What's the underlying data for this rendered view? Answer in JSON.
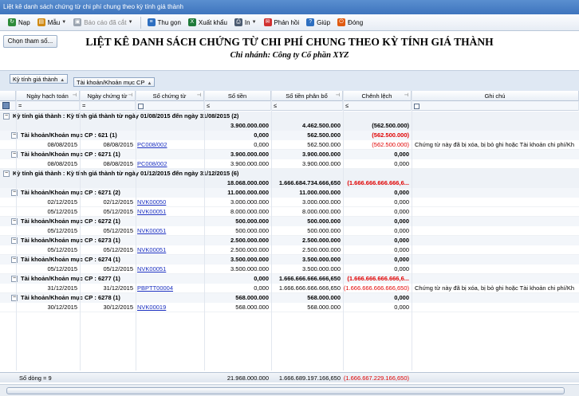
{
  "window": {
    "title": "Liệt kê danh sách chứng từ chi phí chung theo kỳ tính giá thành"
  },
  "toolbar": {
    "items": [
      {
        "label": "Nạp",
        "icon": "refresh-icon",
        "color": "#2e8b3a"
      },
      {
        "label": "Mẫu",
        "icon": "template-icon",
        "color": "#d08a14"
      },
      {
        "label": "Báo cáo đã cắt",
        "icon": "saved-report-icon",
        "color": "#9aa4b0"
      },
      {
        "label": "Thu gọn",
        "icon": "collapse-icon",
        "color": "#2e6fc0"
      },
      {
        "label": "Xuất khẩu",
        "icon": "excel-icon",
        "color": "#1f7a3a"
      },
      {
        "label": "In",
        "icon": "print-icon",
        "color": "#4a5a70"
      },
      {
        "label": "Phản hồi",
        "icon": "feedback-icon",
        "color": "#d03030"
      },
      {
        "label": "Giúp",
        "icon": "help-icon",
        "color": "#2e6fc0"
      },
      {
        "label": "Đóng",
        "icon": "close-icon",
        "color": "#e05a10"
      }
    ]
  },
  "header": {
    "param_button": "Chọn tham số...",
    "title": "LIỆT KÊ DANH SÁCH CHỨNG TỪ CHI PHÍ CHUNG THEO KỲ TÍNH GIÁ THÀNH",
    "subtitle": "Chi nhánh: Công ty Cổ phần XYZ"
  },
  "group_panel": {
    "chip1": "Kỳ tính giá thành",
    "chip2": "Tài khoản/Khoản mục CP"
  },
  "columns": {
    "posting_date": "Ngày hạch toán",
    "voucher_date": "Ngày chứng từ",
    "voucher_no": "Số chứng từ",
    "amount": "Số tiền",
    "allocated": "Số tiền phân bổ",
    "difference": "Chênh lệch",
    "note": "Ghi chú"
  },
  "filter": {
    "eq": "=",
    "le": "≤"
  },
  "rows": [
    {
      "kind": "period",
      "label": "Kỳ tính giá thành : Kỳ tính giá thành từ ngày 01/08/2015 đến ngày 31/08/2015 (2)"
    },
    {
      "kind": "period_sum",
      "amount": "3.900.000.000",
      "allocated": "4.462.500.000",
      "diff": "(562.500.000)",
      "diff_red": false
    },
    {
      "kind": "account",
      "label": "Tài khoản/Khoản mục CP : 621 (1)",
      "amount": "0,000",
      "allocated": "562.500.000",
      "diff": "(562.500.000)",
      "diff_red": true
    },
    {
      "kind": "detail",
      "posting": "08/08/2015",
      "vdate": "08/08/2015",
      "vno": "PC008/002",
      "amount": "0,000",
      "allocated": "562.500.000",
      "diff": "(562.500.000)",
      "diff_red": true,
      "note": "Chứng từ này đã bị xóa, bị bỏ ghi hoặc Tài khoản chi phí/Kh"
    },
    {
      "kind": "account",
      "label": "Tài khoản/Khoản mục CP : 6271 (1)",
      "amount": "3.900.000.000",
      "allocated": "3.900.000.000",
      "diff": "0,000",
      "diff_red": false
    },
    {
      "kind": "detail",
      "posting": "08/08/2015",
      "vdate": "08/08/2015",
      "vno": "PC008/002",
      "amount": "3.900.000.000",
      "allocated": "3.900.000.000",
      "diff": "0,000",
      "diff_red": false,
      "note": ""
    },
    {
      "kind": "period",
      "label": "Kỳ tính giá thành : Kỳ tính giá thành từ ngày 01/12/2015 đến ngày 31/12/2015 (6)"
    },
    {
      "kind": "period_sum",
      "amount": "18.068.000.000",
      "allocated": "1.666.684.734.666,650",
      "diff": "(1.666.666.666.666,6...",
      "diff_red": true
    },
    {
      "kind": "account",
      "label": "Tài khoản/Khoản mục CP : 6271 (2)",
      "amount": "11.000.000.000",
      "allocated": "11.000.000.000",
      "diff": "0,000",
      "diff_red": false
    },
    {
      "kind": "detail",
      "posting": "02/12/2015",
      "vdate": "02/12/2015",
      "vno": "NVK00050",
      "amount": "3.000.000.000",
      "allocated": "3.000.000.000",
      "diff": "0,000",
      "diff_red": false,
      "note": ""
    },
    {
      "kind": "detail",
      "posting": "05/12/2015",
      "vdate": "05/12/2015",
      "vno": "NVK00051",
      "amount": "8.000.000.000",
      "allocated": "8.000.000.000",
      "diff": "0,000",
      "diff_red": false,
      "note": ""
    },
    {
      "kind": "account",
      "label": "Tài khoản/Khoản mục CP : 6272 (1)",
      "amount": "500.000.000",
      "allocated": "500.000.000",
      "diff": "0,000",
      "diff_red": false
    },
    {
      "kind": "detail",
      "posting": "05/12/2015",
      "vdate": "05/12/2015",
      "vno": "NVK00051",
      "amount": "500.000.000",
      "allocated": "500.000.000",
      "diff": "0,000",
      "diff_red": false,
      "note": ""
    },
    {
      "kind": "account",
      "label": "Tài khoản/Khoản mục CP : 6273 (1)",
      "amount": "2.500.000.000",
      "allocated": "2.500.000.000",
      "diff": "0,000",
      "diff_red": false
    },
    {
      "kind": "detail",
      "posting": "05/12/2015",
      "vdate": "05/12/2015",
      "vno": "NVK00051",
      "amount": "2.500.000.000",
      "allocated": "2.500.000.000",
      "diff": "0,000",
      "diff_red": false,
      "note": ""
    },
    {
      "kind": "account",
      "label": "Tài khoản/Khoản mục CP : 6274 (1)",
      "amount": "3.500.000.000",
      "allocated": "3.500.000.000",
      "diff": "0,000",
      "diff_red": false
    },
    {
      "kind": "detail",
      "posting": "05/12/2015",
      "vdate": "05/12/2015",
      "vno": "NVK00051",
      "amount": "3.500.000.000",
      "allocated": "3.500.000.000",
      "diff": "0,000",
      "diff_red": false,
      "note": ""
    },
    {
      "kind": "account",
      "label": "Tài khoản/Khoản mục CP : 6277 (1)",
      "amount": "0,000",
      "allocated": "1.666.666.666.666,650",
      "diff": "(1.666.666.666.666,6...",
      "diff_red": true
    },
    {
      "kind": "detail",
      "posting": "31/12/2015",
      "vdate": "31/12/2015",
      "vno": "PBPTT00004",
      "amount": "0,000",
      "allocated": "1.666.666.666.666,650",
      "diff": "(1.666.666.666.666,650)",
      "diff_red": true,
      "note": "Chứng từ này đã bị xóa, bị bỏ ghi hoặc Tài khoản chi phí/Kh"
    },
    {
      "kind": "account",
      "label": "Tài khoản/Khoản mục CP : 6278 (1)",
      "amount": "568.000.000",
      "allocated": "568.000.000",
      "diff": "0,000",
      "diff_red": false
    },
    {
      "kind": "detail",
      "posting": "30/12/2015",
      "vdate": "30/12/2015",
      "vno": "NVK00019",
      "amount": "568.000.000",
      "allocated": "568.000.000",
      "diff": "0,000",
      "diff_red": false,
      "note": ""
    }
  ],
  "footer": {
    "row_count": "Số dòng = 9",
    "amount": "21.968.000.000",
    "allocated": "1.666.689.197.166,650",
    "diff": "(1.666.667.229.166,650)"
  },
  "colors": {
    "red": "#e00000",
    "link": "#1a2fc0",
    "title_bar": "#3e74bd"
  }
}
